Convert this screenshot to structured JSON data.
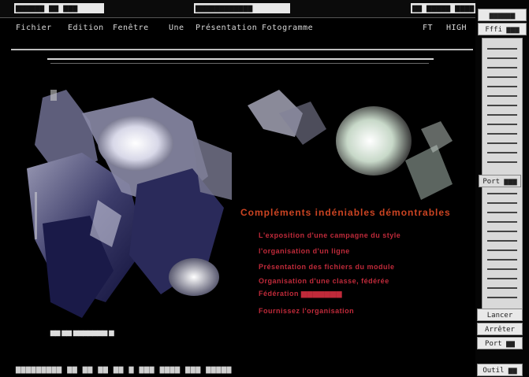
{
  "window": {
    "title_left": "▆▆▆▆▆▆ ▆▆ ▆▆▆",
    "title_center": "▆▆▆▆▆▆▆▆▆▆▆▆",
    "title_right": "▆▆ ▆▆▆▆▆ ▆▆▆▆"
  },
  "menu": {
    "items": [
      "Fichier",
      "Edition",
      "Fenêtre",
      "Une",
      "Présentation",
      "Fotogramme"
    ],
    "right_items": [
      "FT",
      "HIGH"
    ]
  },
  "tools": {
    "top_labels": [
      "▆▆▆▆▆▆",
      "Fffi ▆▆▆"
    ],
    "mid_label": "Port ▆▆▆",
    "bottom_labels": [
      "Lancer",
      "Arrêter",
      "Port ▆▆"
    ],
    "status_button": "Outil ▆▆"
  },
  "content": {
    "headline": "Compléments indéniables démontrables",
    "bullets": [
      "L'exposition d'une campagne du style",
      "l'organisation d'un ligne",
      "Présentation des fichiers du module",
      "Organisation d'une classe, fédérée",
      "Fédération ▆▆▆▆▆▆▆",
      "Fournissez l'organisation"
    ],
    "caption": "▆▆ ▆▆ ▆▆▆▆▆▆▆ ▆",
    "accent_color": "#c02a3a"
  },
  "status": {
    "text": "▆▆▆▆▆▆▆▆▆ ▆▆ ▆▆ ▆▆ ▆▆ ▆ ▆▆▆ ▆▆▆▆ ▆▆▆ ▆▆▆▆▆"
  }
}
